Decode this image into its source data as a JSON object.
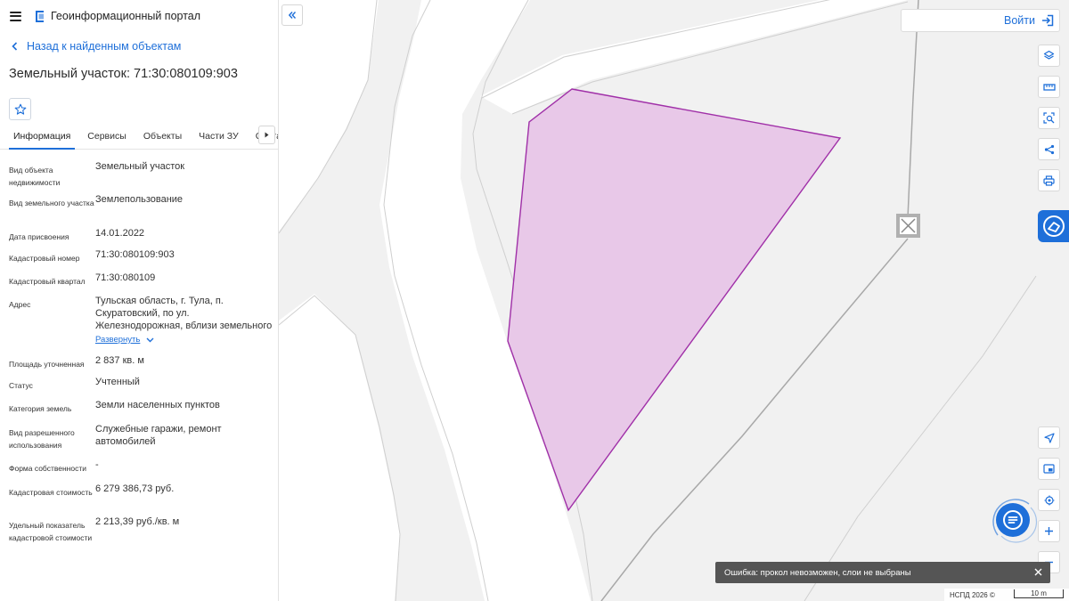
{
  "app": {
    "title": "Геоинформационный портал"
  },
  "navigation": {
    "back_label": "Назад к найденным объектам"
  },
  "object": {
    "title": "Земельный участок: 71:30:080109:903"
  },
  "tabs": [
    {
      "label": "Информация",
      "active": true
    },
    {
      "label": "Сервисы",
      "active": false
    },
    {
      "label": "Объекты",
      "active": false
    },
    {
      "label": "Части ЗУ",
      "active": false
    },
    {
      "label": "Состав",
      "active": false
    }
  ],
  "properties": [
    {
      "label": "Вид объекта недвижимости",
      "value": "Земельный участок"
    },
    {
      "label": "Вид земельного участка",
      "value": "Землепользование"
    },
    {
      "label": "Дата присвоения",
      "value": "14.01.2022"
    },
    {
      "label": "Кадастровый номер",
      "value": "71:30:080109:903"
    },
    {
      "label": "Кадастровый квартал",
      "value": "71:30:080109"
    },
    {
      "label": "Адрес",
      "value": "Тульская область, г. Тула, п. Скуратовский, по ул. Железнодорожная, вблизи земельного",
      "expand_label": "Развернуть"
    },
    {
      "label": "Площадь уточненная",
      "value": "2 837 кв. м"
    },
    {
      "label": "Статус",
      "value": "Учтенный"
    },
    {
      "label": "Категория земель",
      "value": "Земли населенных пунктов"
    },
    {
      "label": "Вид разрешенного использования",
      "value": "Служебные гаражи, ремонт автомобилей"
    },
    {
      "label": "Форма собственности",
      "value": "-"
    },
    {
      "label": "Кадастровая стоимость",
      "value": "6 279 386,73 руб."
    },
    {
      "label": "Удельный показатель кадастровой стоимости",
      "value": "2 213,39 руб./кв. м"
    }
  ],
  "map": {
    "login_label": "Войти",
    "toast_message": "Ошибка: прокол невозможен, слои не выбраны",
    "attribution": "НСПД 2026 ©",
    "scale_label": "10 m",
    "parcel_fill": "#e8c8e8",
    "parcel_stroke": "#a030a8"
  },
  "colors": {
    "accent": "#1e6fd9",
    "toast_bg": "#555555"
  }
}
